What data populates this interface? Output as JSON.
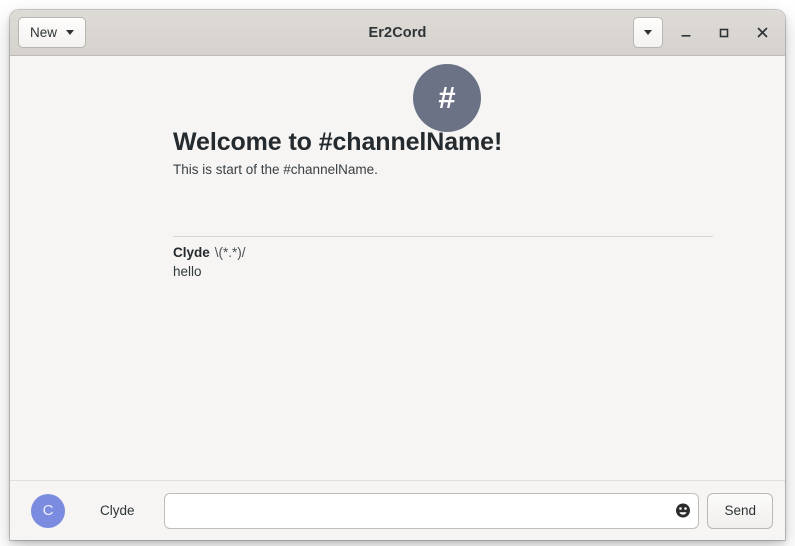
{
  "window": {
    "title": "Er2Cord",
    "new_button_label": "New",
    "new_button_icon": "chevron-down-icon",
    "menu_button_icon": "chevron-down-icon",
    "minimize_icon": "minimize-icon",
    "maximize_icon": "maximize-icon",
    "close_icon": "close-icon"
  },
  "channel": {
    "avatar_glyph": "#",
    "avatar_color": "#6b7285",
    "welcome_title": "Welcome to #channelName!",
    "welcome_subtitle": "This is start of the #channelName."
  },
  "messages": [
    {
      "author": "Clyde",
      "meta": "\\(*.*)/",
      "body": "hello"
    }
  ],
  "composer": {
    "avatar_initial": "C",
    "avatar_color": "#7b8ce0",
    "user_name": "Clyde",
    "input_value": "",
    "input_placeholder": "",
    "emoji_icon": "smiley-face-icon",
    "send_label": "Send"
  }
}
